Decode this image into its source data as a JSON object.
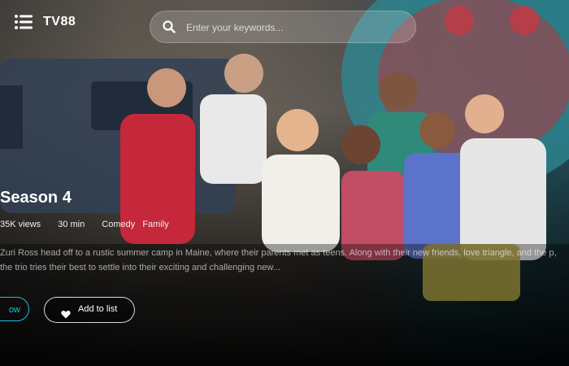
{
  "app": {
    "brand": "TV88"
  },
  "search": {
    "placeholder": "Enter your keywords..."
  },
  "feature": {
    "title": "Season 4",
    "views": "35K views",
    "duration": "30 min",
    "genres": [
      "Comedy",
      "Family"
    ],
    "description": "Zuri Ross head off to a rustic summer camp in Maine, where their parents met as teens. Along with their new friends, love triangle, and the p, the trio tries their best to settle into their exciting and challenging new..."
  },
  "actions": {
    "play_label": "ow",
    "add_to_list_label": "Add to list"
  },
  "icons": {
    "menu": "menu-icon",
    "search": "search-icon",
    "add_to_list": "heart-icon"
  },
  "colors": {
    "accent": "#19c0e3",
    "background": "#151515"
  }
}
